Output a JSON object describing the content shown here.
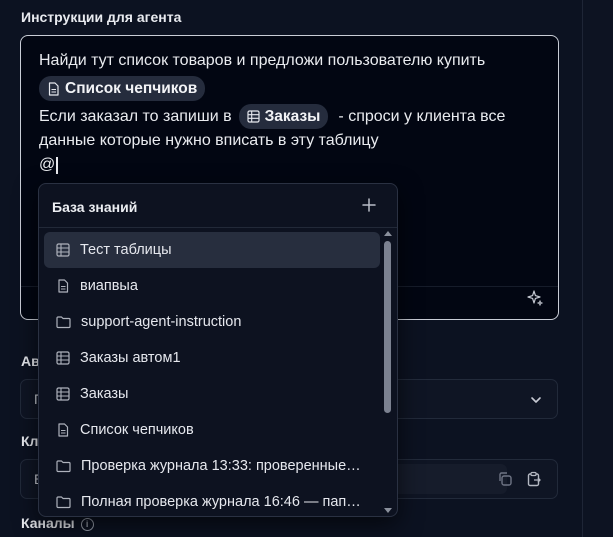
{
  "section_title": "Инструкции для агента",
  "editor": {
    "line1": "Найди тут список товаров и предложи пользователю купить",
    "chip1": "Список чепчиков",
    "line3_before": "Если заказал то запиши в",
    "chip2": "Заказы",
    "line3_after": "-  спроси у клиента все",
    "line4": "данные которые нужно вписать в эту таблицу",
    "line5": "@"
  },
  "background": {
    "label1": "Ав",
    "field1_prefix": "П",
    "label2": "Кл",
    "field2_prefix": "E",
    "label3": "Каналы"
  },
  "dropdown": {
    "title": "База знаний",
    "items": [
      {
        "label": "Тест таблицы",
        "icon": "table-icon"
      },
      {
        "label": "виапвыа",
        "icon": "document-icon"
      },
      {
        "label": "support-agent-instruction",
        "icon": "folder-icon"
      },
      {
        "label": "Заказы автом1",
        "icon": "table-icon"
      },
      {
        "label": "Заказы",
        "icon": "table-icon"
      },
      {
        "label": "Список чепчиков",
        "icon": "document-icon"
      },
      {
        "label": "Проверка журнала 13:33: проверенные…",
        "icon": "folder-icon"
      },
      {
        "label": "Полная проверка журнала 16:46 — пап…",
        "icon": "folder-icon"
      }
    ]
  },
  "colors": {
    "background": "#0c1221",
    "editor_border": "#c9cdd6",
    "chip_bg": "#252c3d",
    "active_item_bg": "#272e3e"
  }
}
